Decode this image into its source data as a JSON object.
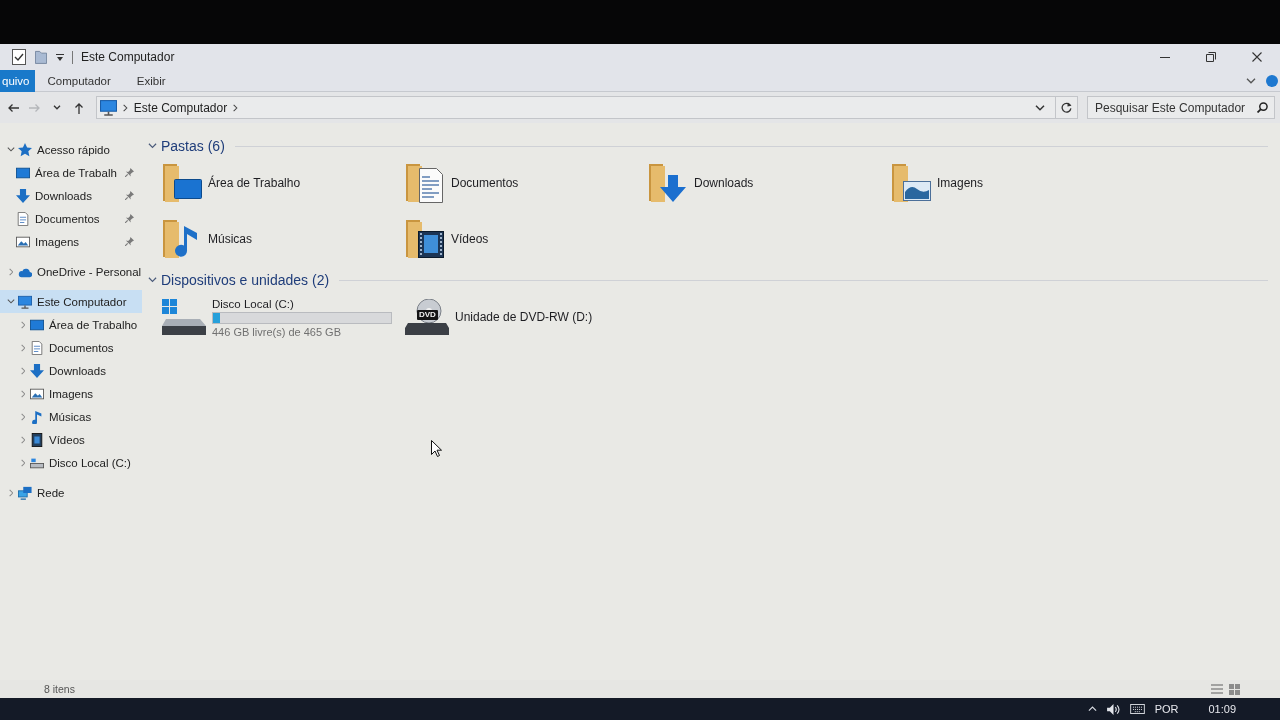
{
  "window": {
    "title": "Este Computador"
  },
  "ribbon_tabs": [
    {
      "label": "quivo",
      "selected": true
    },
    {
      "label": "Computador",
      "selected": false
    },
    {
      "label": "Exibir",
      "selected": false
    }
  ],
  "nav_buttons": [
    {
      "kind": "back",
      "disabled": false
    },
    {
      "kind": "forward",
      "disabled": true
    },
    {
      "kind": "recent",
      "disabled": false
    },
    {
      "kind": "up",
      "disabled": false
    }
  ],
  "address_bar": {
    "path": [
      "Este Computador"
    ]
  },
  "search": {
    "placeholder": "Pesquisar Este Computador"
  },
  "sidebar": {
    "items": [
      {
        "kind": "star",
        "label": "Acesso rápido",
        "expanded": true,
        "selected": false,
        "children": [
          {
            "kind": "desktop",
            "label": "Área de Trabalh",
            "pinned": true,
            "selected": false
          },
          {
            "kind": "downloads",
            "label": "Downloads",
            "pinned": true,
            "selected": false
          },
          {
            "kind": "documents",
            "label": "Documentos",
            "pinned": true,
            "selected": false
          },
          {
            "kind": "pictures",
            "label": "Imagens",
            "pinned": true,
            "selected": false
          }
        ]
      },
      {
        "kind": "cloud",
        "label": "OneDrive - Personal",
        "expanded": false,
        "selected": false
      },
      {
        "kind": "computer",
        "label": "Este Computador",
        "expanded": true,
        "selected": true,
        "children": [
          {
            "kind": "desktop",
            "label": "Área de Trabalho",
            "expanded": false,
            "selected": false
          },
          {
            "kind": "documents",
            "label": "Documentos",
            "expanded": false,
            "selected": false
          },
          {
            "kind": "downloads",
            "label": "Downloads",
            "expanded": false,
            "selected": false
          },
          {
            "kind": "pictures",
            "label": "Imagens",
            "expanded": false,
            "selected": false
          },
          {
            "kind": "music",
            "label": "Músicas",
            "expanded": false,
            "selected": false
          },
          {
            "kind": "videos",
            "label": "Vídeos",
            "expanded": false,
            "selected": false
          },
          {
            "kind": "drive",
            "label": "Disco Local (C:)",
            "expanded": false,
            "selected": false
          }
        ]
      },
      {
        "kind": "network",
        "label": "Rede",
        "expanded": false,
        "selected": false
      }
    ]
  },
  "groups": [
    {
      "title": "Pastas (6)",
      "expanded": true,
      "items": [
        {
          "kind": "desktop",
          "name": "Área de Trabalho"
        },
        {
          "kind": "documents",
          "name": "Documentos"
        },
        {
          "kind": "downloads",
          "name": "Downloads"
        },
        {
          "kind": "pictures",
          "name": "Imagens"
        },
        {
          "kind": "music",
          "name": "Músicas"
        },
        {
          "kind": "videos",
          "name": "Vídeos"
        }
      ]
    },
    {
      "title": "Dispositivos e unidades (2)",
      "expanded": true,
      "items": [
        {
          "kind": "disk",
          "name": "Disco Local (C:)",
          "level": 0.04,
          "free": "446 GB livre(s) de 465 GB"
        },
        {
          "kind": "dvd",
          "name": "Unidade de DVD-RW (D:)",
          "badge": "DVD"
        }
      ]
    }
  ],
  "status_bar": {
    "text": "8 itens"
  },
  "taskbar": {
    "language": "POR",
    "time": "01:09"
  }
}
